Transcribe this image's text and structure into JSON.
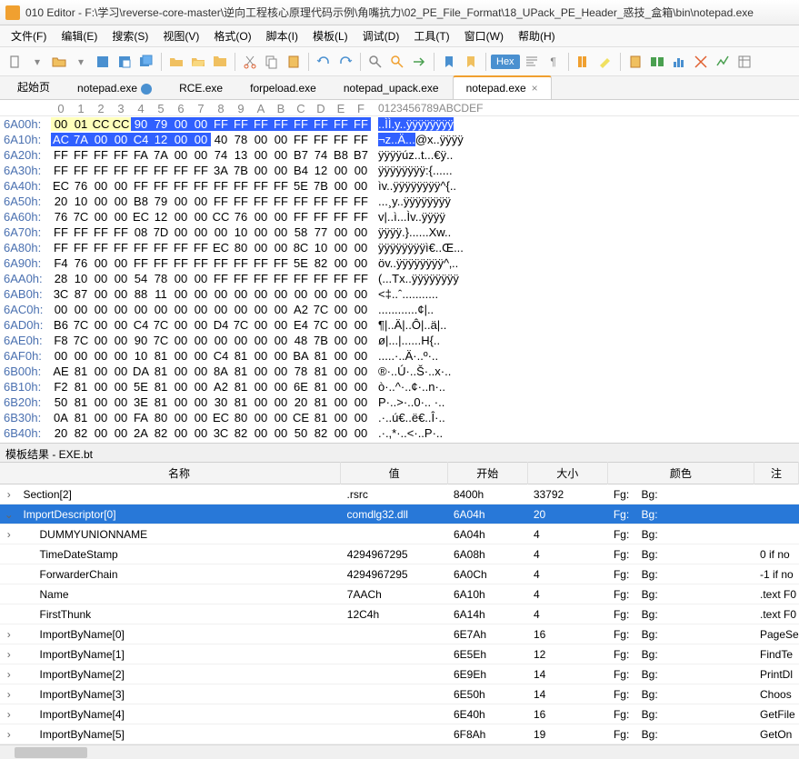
{
  "window": {
    "title": "010 Editor - F:\\学习\\reverse-core-master\\逆向工程核心原理代码示例\\角嘴抗力\\02_PE_File_Format\\18_UPack_PE_Header_惑技_盒箱\\bin\\notepad.exe"
  },
  "menu": {
    "items": [
      {
        "label": "文件(F)"
      },
      {
        "label": "编辑(E)"
      },
      {
        "label": "搜索(S)"
      },
      {
        "label": "视图(V)"
      },
      {
        "label": "格式(O)"
      },
      {
        "label": "脚本(I)"
      },
      {
        "label": "模板(L)"
      },
      {
        "label": "调试(D)"
      },
      {
        "label": "工具(T)"
      },
      {
        "label": "窗口(W)"
      },
      {
        "label": "帮助(H)"
      }
    ]
  },
  "toolbar": {
    "hex_label": "Hex"
  },
  "tabs": {
    "items": [
      {
        "label": "起始页"
      },
      {
        "label": "notepad.exe",
        "icon": true
      },
      {
        "label": "RCE.exe"
      },
      {
        "label": "forpeload.exe"
      },
      {
        "label": "notepad_upack.exe"
      },
      {
        "label": "notepad.exe",
        "close": true,
        "active": true
      }
    ]
  },
  "hex": {
    "col_header": [
      "0",
      "1",
      "2",
      "3",
      "4",
      "5",
      "6",
      "7",
      "8",
      "9",
      "A",
      "B",
      "C",
      "D",
      "E",
      "F"
    ],
    "ascii_header": "0123456789ABCDEF",
    "rows": [
      {
        "off": "6A00h:",
        "b": [
          "00",
          "01",
          "CC",
          "CC",
          "90",
          "79",
          "00",
          "00",
          "FF",
          "FF",
          "FF",
          "FF",
          "FF",
          "FF",
          "FF",
          "FF"
        ],
        "a": "..ÌÌ.y..ÿÿÿÿÿÿÿÿ",
        "hl": {
          "y": [
            0,
            1,
            2,
            3
          ],
          "b": [
            4,
            5,
            6,
            7,
            8,
            9,
            10,
            11,
            12,
            13,
            14,
            15
          ]
        },
        "ahl": [
          0,
          16
        ]
      },
      {
        "off": "6A10h:",
        "b": [
          "AC",
          "7A",
          "00",
          "00",
          "C4",
          "12",
          "00",
          "00",
          "40",
          "78",
          "00",
          "00",
          "FF",
          "FF",
          "FF",
          "FF"
        ],
        "a": "¬z..Ä...@x..ÿÿÿÿ",
        "hl": {
          "b": [
            0,
            1,
            2,
            3,
            4,
            5,
            6,
            7
          ]
        },
        "ahl": [
          0,
          8
        ]
      },
      {
        "off": "6A20h:",
        "b": [
          "FF",
          "FF",
          "FF",
          "FF",
          "FA",
          "7A",
          "00",
          "00",
          "74",
          "13",
          "00",
          "00",
          "B7",
          "74",
          "B8",
          "B7"
        ],
        "a": "ÿÿÿÿúz..t...€ÿ.."
      },
      {
        "off": "6A30h:",
        "b": [
          "FF",
          "FF",
          "FF",
          "FF",
          "FF",
          "FF",
          "FF",
          "FF",
          "3A",
          "7B",
          "00",
          "00",
          "B4",
          "12",
          "00",
          "00"
        ],
        "a": "ÿÿÿÿÿÿÿÿ:{......"
      },
      {
        "off": "6A40h:",
        "b": [
          "EC",
          "76",
          "00",
          "00",
          "FF",
          "FF",
          "FF",
          "FF",
          "FF",
          "FF",
          "FF",
          "FF",
          "5E",
          "7B",
          "00",
          "00"
        ],
        "a": "ìv..ÿÿÿÿÿÿÿÿ^{.."
      },
      {
        "off": "6A50h:",
        "b": [
          "20",
          "10",
          "00",
          "00",
          "B8",
          "79",
          "00",
          "00",
          "FF",
          "FF",
          "FF",
          "FF",
          "FF",
          "FF",
          "FF",
          "FF"
        ],
        "a": " ...¸y..ÿÿÿÿÿÿÿÿ"
      },
      {
        "off": "6A60h:",
        "b": [
          "76",
          "7C",
          "00",
          "00",
          "EC",
          "12",
          "00",
          "00",
          "CC",
          "76",
          "00",
          "00",
          "FF",
          "FF",
          "FF",
          "FF"
        ],
        "a": "v|..ì...Ìv..ÿÿÿÿ"
      },
      {
        "off": "6A70h:",
        "b": [
          "FF",
          "FF",
          "FF",
          "FF",
          "08",
          "7D",
          "00",
          "00",
          "00",
          "10",
          "00",
          "00",
          "58",
          "77",
          "00",
          "00"
        ],
        "a": "ÿÿÿÿ.}......Xw.."
      },
      {
        "off": "6A80h:",
        "b": [
          "FF",
          "FF",
          "FF",
          "FF",
          "FF",
          "FF",
          "FF",
          "FF",
          "EC",
          "80",
          "00",
          "00",
          "8C",
          "10",
          "00",
          "00"
        ],
        "a": "ÿÿÿÿÿÿÿÿì€..Œ..."
      },
      {
        "off": "6A90h:",
        "b": [
          "F4",
          "76",
          "00",
          "00",
          "FF",
          "FF",
          "FF",
          "FF",
          "FF",
          "FF",
          "FF",
          "FF",
          "5E",
          "82",
          "00",
          "00"
        ],
        "a": "öv..ÿÿÿÿÿÿÿÿ^‚.."
      },
      {
        "off": "6AA0h:",
        "b": [
          "28",
          "10",
          "00",
          "00",
          "54",
          "78",
          "00",
          "00",
          "FF",
          "FF",
          "FF",
          "FF",
          "FF",
          "FF",
          "FF",
          "FF"
        ],
        "a": "(...Tx..ÿÿÿÿÿÿÿÿ"
      },
      {
        "off": "6AB0h:",
        "b": [
          "3C",
          "87",
          "00",
          "00",
          "88",
          "11",
          "00",
          "00",
          "00",
          "00",
          "00",
          "00",
          "00",
          "00",
          "00",
          "00"
        ],
        "a": "<‡..ˆ..........."
      },
      {
        "off": "6AC0h:",
        "b": [
          "00",
          "00",
          "00",
          "00",
          "00",
          "00",
          "00",
          "00",
          "00",
          "00",
          "00",
          "00",
          "A2",
          "7C",
          "00",
          "00"
        ],
        "a": "............¢|.."
      },
      {
        "off": "6AD0h:",
        "b": [
          "B6",
          "7C",
          "00",
          "00",
          "C4",
          "7C",
          "00",
          "00",
          "D4",
          "7C",
          "00",
          "00",
          "E4",
          "7C",
          "00",
          "00"
        ],
        "a": "¶|..Ä|..Ô|..ä|.."
      },
      {
        "off": "6AE0h:",
        "b": [
          "F8",
          "7C",
          "00",
          "00",
          "90",
          "7C",
          "00",
          "00",
          "00",
          "00",
          "00",
          "00",
          "48",
          "7B",
          "00",
          "00"
        ],
        "a": "ø|...|......H{.."
      },
      {
        "off": "6AF0h:",
        "b": [
          "00",
          "00",
          "00",
          "00",
          "10",
          "81",
          "00",
          "00",
          "C4",
          "81",
          "00",
          "00",
          "BA",
          "81",
          "00",
          "00"
        ],
        "a": ".....·..Ä·..º·.."
      },
      {
        "off": "6B00h:",
        "b": [
          "AE",
          "81",
          "00",
          "00",
          "DA",
          "81",
          "00",
          "00",
          "8A",
          "81",
          "00",
          "00",
          "78",
          "81",
          "00",
          "00"
        ],
        "a": "®·..Ú·..Š·..x·.."
      },
      {
        "off": "6B10h:",
        "b": [
          "F2",
          "81",
          "00",
          "00",
          "5E",
          "81",
          "00",
          "00",
          "A2",
          "81",
          "00",
          "00",
          "6E",
          "81",
          "00",
          "00"
        ],
        "a": "ò·..^·..¢·..n·.."
      },
      {
        "off": "6B20h:",
        "b": [
          "50",
          "81",
          "00",
          "00",
          "3E",
          "81",
          "00",
          "00",
          "30",
          "81",
          "00",
          "00",
          "20",
          "81",
          "00",
          "00"
        ],
        "a": "P·..>·..0·.. ·.."
      },
      {
        "off": "6B30h:",
        "b": [
          "0A",
          "81",
          "00",
          "00",
          "FA",
          "80",
          "00",
          "00",
          "EC",
          "80",
          "00",
          "00",
          "CE",
          "81",
          "00",
          "00"
        ],
        "a": ".·..ú€..ë€..Î·.."
      },
      {
        "off": "6B40h:",
        "b": [
          "20",
          "82",
          "00",
          "00",
          "2A",
          "82",
          "00",
          "00",
          "3C",
          "82",
          "00",
          "00",
          "50",
          "82",
          "00",
          "00"
        ],
        "a": ".·.,*·..<·..P·.."
      }
    ]
  },
  "template": {
    "pane_title": "模板结果 - EXE.bt",
    "headers": {
      "name": "名称",
      "value": "值",
      "start": "开始",
      "size": "大小",
      "color": "颜色",
      "note": "注"
    },
    "fg": "Fg:",
    "bg": "Bg:",
    "rows": [
      {
        "exp": "›",
        "ind": 0,
        "name": "Section[2]",
        "val": ".rsrc",
        "start": "8400h",
        "size": "33792",
        "note": ""
      },
      {
        "exp": "⌄",
        "ind": 0,
        "name": "ImportDescriptor[0]",
        "val": "comdlg32.dll",
        "start": "6A04h",
        "size": "20",
        "note": "",
        "sel": true
      },
      {
        "exp": "›",
        "ind": 1,
        "name": "DUMMYUNIONNAME",
        "val": "",
        "start": "6A04h",
        "size": "4",
        "note": ""
      },
      {
        "exp": "",
        "ind": 1,
        "name": "TimeDateStamp",
        "val": "4294967295",
        "start": "6A08h",
        "size": "4",
        "note": "0 if no"
      },
      {
        "exp": "",
        "ind": 1,
        "name": "ForwarderChain",
        "val": "4294967295",
        "start": "6A0Ch",
        "size": "4",
        "note": "-1 if no"
      },
      {
        "exp": "",
        "ind": 1,
        "name": "Name",
        "val": "7AACh",
        "start": "6A10h",
        "size": "4",
        "note": ".text F0"
      },
      {
        "exp": "",
        "ind": 1,
        "name": "FirstThunk",
        "val": "12C4h",
        "start": "6A14h",
        "size": "4",
        "note": ".text F0"
      },
      {
        "exp": "›",
        "ind": 1,
        "name": "ImportByName[0]",
        "val": "",
        "start": "6E7Ah",
        "size": "16",
        "note": "PageSe"
      },
      {
        "exp": "›",
        "ind": 1,
        "name": "ImportByName[1]",
        "val": "",
        "start": "6E5Eh",
        "size": "12",
        "note": "FindTe"
      },
      {
        "exp": "›",
        "ind": 1,
        "name": "ImportByName[2]",
        "val": "",
        "start": "6E9Eh",
        "size": "14",
        "note": "PrintDl"
      },
      {
        "exp": "›",
        "ind": 1,
        "name": "ImportByName[3]",
        "val": "",
        "start": "6E50h",
        "size": "14",
        "note": "Choos"
      },
      {
        "exp": "›",
        "ind": 1,
        "name": "ImportByName[4]",
        "val": "",
        "start": "6E40h",
        "size": "16",
        "note": "GetFile"
      },
      {
        "exp": "›",
        "ind": 1,
        "name": "ImportByName[5]",
        "val": "",
        "start": "6F8Ah",
        "size": "19",
        "note": "GetOn"
      }
    ]
  }
}
